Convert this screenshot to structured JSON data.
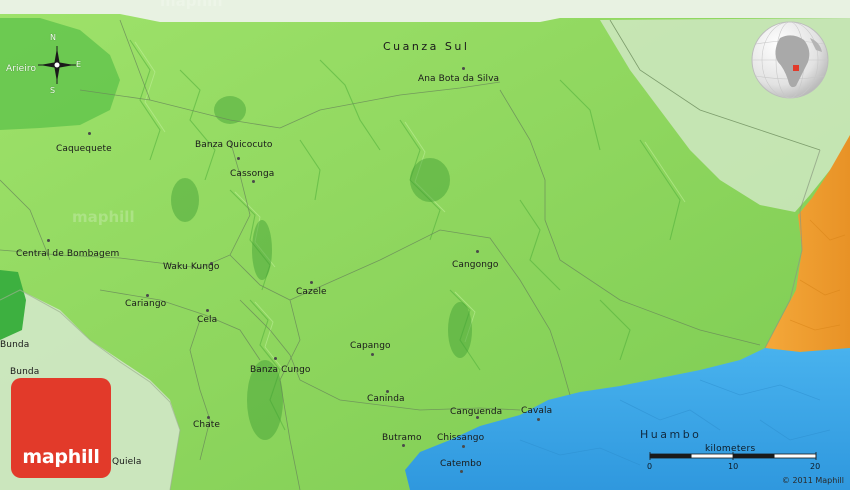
{
  "map": {
    "watermark": "maphill",
    "logo_text": "maphill",
    "copyright": "© 2011 Maphill",
    "regions": {
      "cuanza_sul": "Cuanza Sul",
      "huambo": "Huambo"
    },
    "compass": {
      "n": "N",
      "e": "E",
      "s": "S"
    },
    "scale": {
      "title": "kilometers",
      "ticks": [
        "0",
        "10",
        "20"
      ]
    },
    "places": [
      {
        "name": "Arieiro",
        "theme": "light"
      },
      {
        "name": "Ana Bota da Silva"
      },
      {
        "name": "Caquequete"
      },
      {
        "name": "Banza Quicocuto"
      },
      {
        "name": "Cassonga"
      },
      {
        "name": "Central de Bombagem"
      },
      {
        "name": "Waku Kungo"
      },
      {
        "name": "Cangongo"
      },
      {
        "name": "Cazele"
      },
      {
        "name": "Cariango"
      },
      {
        "name": "Cela"
      },
      {
        "name": "Bunda"
      },
      {
        "name": "Bunda"
      },
      {
        "name": "Capango"
      },
      {
        "name": "Banza Cungo"
      },
      {
        "name": "Caninda"
      },
      {
        "name": "Canguenda"
      },
      {
        "name": "Cavala"
      },
      {
        "name": "Chate"
      },
      {
        "name": "Butramo"
      },
      {
        "name": "Chissango"
      },
      {
        "name": "Catembo"
      },
      {
        "name": "Quiela"
      }
    ],
    "colors": {
      "land": "#8fd860",
      "land_dark": "#3ea832",
      "outside_area": "#d8ead0",
      "huambo_water": "#3aa6e8",
      "orange_region": "#f0a030",
      "logo": "#e23a2a"
    }
  }
}
